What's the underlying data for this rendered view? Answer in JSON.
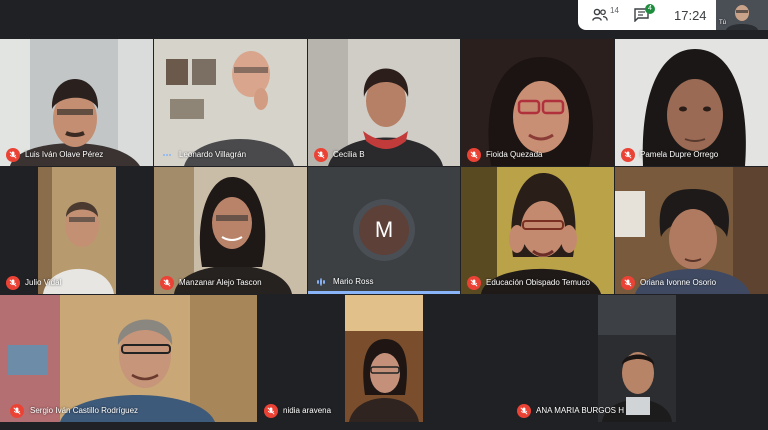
{
  "header": {
    "participants_count": "14",
    "chat_badge": "4",
    "time": "17:24",
    "self_label": "Tú"
  },
  "colors": {
    "mic_off": "#ea4335",
    "active_speaker": "#8ab4f8",
    "avatar_bg": "#5d4037",
    "background": "#202124"
  },
  "participants": [
    {
      "name": "Luis Iván Olave Pérez",
      "status": "muted"
    },
    {
      "name": "Leonardo Villagrán",
      "status": "unmuted"
    },
    {
      "name": "Cecilia B",
      "status": "muted"
    },
    {
      "name": "Fioida Quezada",
      "status": "muted"
    },
    {
      "name": "Pamela Dupre Orrego",
      "status": "muted"
    },
    {
      "name": "Julio Vidal",
      "status": "muted"
    },
    {
      "name": "Manzanar Alejo Tascon",
      "status": "muted"
    },
    {
      "name": "Mario Ross",
      "status": "speaking",
      "avatar_letter": "M"
    },
    {
      "name": "Educación Obispado Temuco",
      "status": "muted"
    },
    {
      "name": "Oriana Ivonne Osorio",
      "status": "muted"
    },
    {
      "name": "Sergio Iván Castillo Rodríguez",
      "status": "muted"
    },
    {
      "name": "nidia aravena",
      "status": "muted"
    },
    {
      "name": "ANA MARIA BURGOS H",
      "status": "muted"
    }
  ]
}
